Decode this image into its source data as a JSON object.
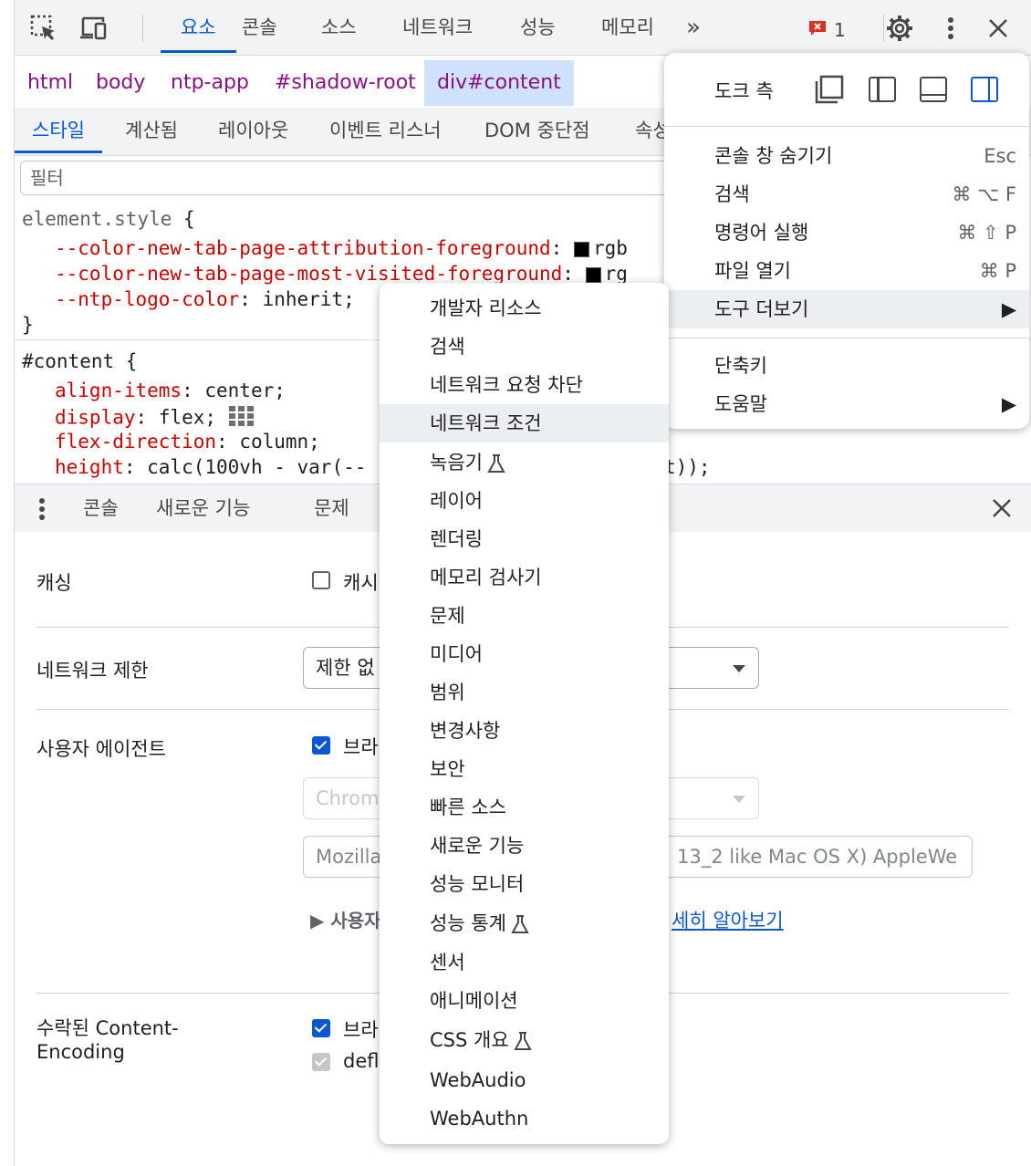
{
  "toolbar": {
    "tabs": [
      "요소",
      "콘솔",
      "소스",
      "네트워크",
      "성능",
      "메모리"
    ],
    "active_tab": "요소",
    "more_label": "»",
    "error_count": "1",
    "accent_color": "#0b57d0"
  },
  "breadcrumbs": [
    "html",
    "body",
    "ntp-app",
    "#shadow-root",
    "div#content"
  ],
  "subtabs": [
    "스타일",
    "계산됨",
    "레이아웃",
    "이벤트 리스너",
    "DOM 중단점",
    "속성"
  ],
  "filter": {
    "placeholder": "필터"
  },
  "styles": {
    "element_style_selector": "element.style",
    "element_props": [
      {
        "name": "--color-new-tab-page-attribution-foreground",
        "value": "rgb"
      },
      {
        "name": "--color-new-tab-page-most-visited-foreground",
        "value": "rg"
      },
      {
        "name": "--ntp-logo-color",
        "value": "inherit;"
      }
    ],
    "content_selector": "#content",
    "content_props": [
      {
        "name": "align-items",
        "value": "center;"
      },
      {
        "name": "display",
        "value": "flex;"
      },
      {
        "name": "flex-direction",
        "value": "column;"
      },
      {
        "name": "height",
        "value": "calc(100vh - var(--"
      }
    ],
    "height_tail": "t));"
  },
  "drawer": {
    "tabs": [
      "콘솔",
      "새로운 기능",
      "문제"
    ],
    "caching_label": "캐싱",
    "caching_checkbox": "캐시",
    "throttle_label": "네트워크 제한",
    "throttle_value": "제한 없",
    "ua_label": "사용자 에이전트",
    "ua_checkbox": "브라",
    "ua_select_value": "Chrom",
    "ua_input_left": "Mozilla",
    "ua_input_right": "13_2 like Mac OS X) AppleWe",
    "ua_hint": "▶ 사용자",
    "learn_more": "세히 알아보기",
    "encoding_label_1": "수락된 Content-",
    "encoding_label_2": "Encoding",
    "encoding_check_1": "브라",
    "encoding_check_2": "defl"
  },
  "main_menu": {
    "dock_label": "도크 측",
    "items": [
      {
        "label": "콘솔 창 숨기기",
        "shortcut": "Esc"
      },
      {
        "label": "검색",
        "shortcut": "⌘ ⌥ F"
      },
      {
        "label": "명령어 실행",
        "shortcut": "⌘ ⇧ P"
      },
      {
        "label": "파일 열기",
        "shortcut": "⌘ P"
      },
      {
        "label": "도구 더보기",
        "shortcut": "▶"
      }
    ],
    "items2": [
      {
        "label": "단축키",
        "shortcut": ""
      },
      {
        "label": "도움말",
        "shortcut": "▶"
      }
    ]
  },
  "sub_menu": {
    "items": [
      "개발자 리소스",
      "검색",
      "네트워크 요청 차단",
      "네트워크 조건",
      "녹음기",
      "레이어",
      "렌더링",
      "메모리 검사기",
      "문제",
      "미디어",
      "범위",
      "변경사항",
      "보안",
      "빠른 소스",
      "새로운 기능",
      "성능 모니터",
      "성능 통계",
      "센서",
      "애니메이션",
      "CSS 개요",
      "WebAudio",
      "WebAuthn"
    ],
    "highlighted": "네트워크 조건"
  }
}
